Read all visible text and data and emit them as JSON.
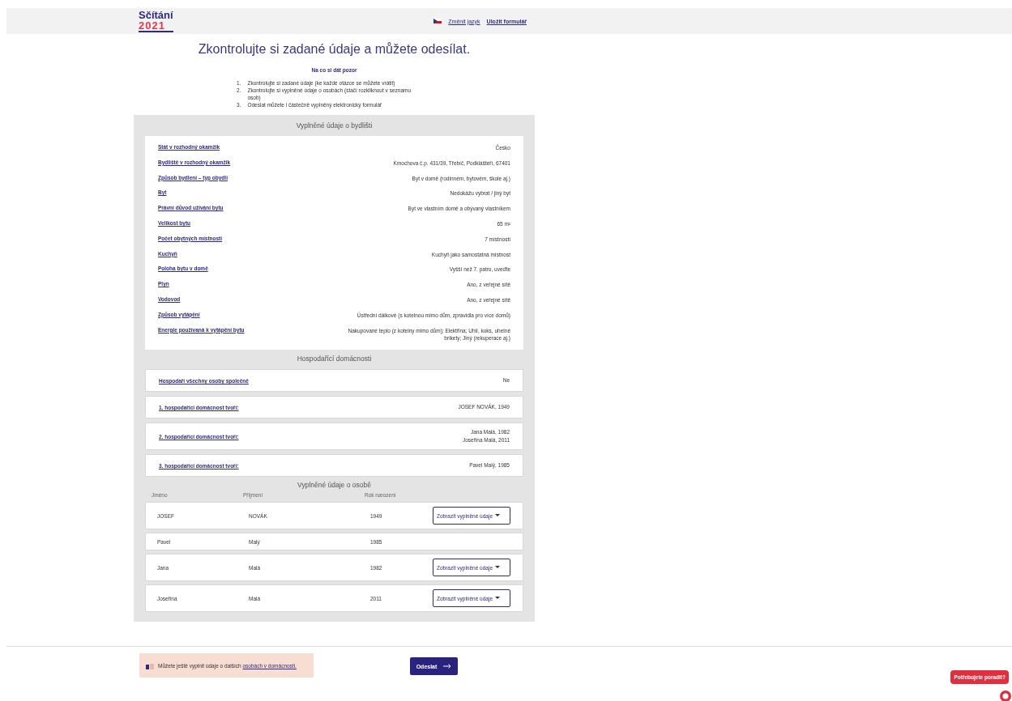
{
  "header": {
    "logo_word": "Sčítání",
    "logo_year": "2021",
    "language_link": "Změnit jazyk",
    "save_link": "Uložit formulář"
  },
  "title": "Zkontrolujte si zadané údaje a můžete odesílat.",
  "instructions": {
    "heading": "Na co si dát pozor",
    "items": [
      {
        "number": "1.",
        "text": "Zkontrolujte si zadané údaje (ke každé otázce se můžete vrátit)"
      },
      {
        "number": "2.",
        "text": "Zkontrolujte si vyplněné údaje o osobách (stačí rozkliknout v seznamu osob)"
      },
      {
        "number": "3.",
        "text": "Odeslat můžete i částečně vyplněný elektronický formulář"
      }
    ]
  },
  "dwelling": {
    "heading": "Vyplněné údaje o bydlišti",
    "rows": [
      {
        "label": "Stát v rozhodný okamžik",
        "value": "Česko"
      },
      {
        "label": "Bydliště v rozhodný okamžik",
        "value": "Kmochova č.p. 431/39, Třebíč, Podklášteří, 67401"
      },
      {
        "label": "Způsob bydlení – typ obydlí",
        "value": "Byt v domě (rodinném, bytovém, škole aj.)"
      },
      {
        "label": "Byt",
        "value": "Nedokážu vybrat / jiný byt"
      },
      {
        "label": "Právní důvod užívání bytu",
        "value": "Byt ve vlastním domě a obývaný vlastníkem"
      },
      {
        "label": "Velikost bytu",
        "value": "65 m²"
      },
      {
        "label": "Počet obytných místností",
        "value": "7 místností"
      },
      {
        "label": "Kuchyň",
        "value": "Kuchyň jako samostatná místnost"
      },
      {
        "label": "Poloha bytu v domě",
        "value": "Vyšší než 7. patro, uveďte"
      },
      {
        "label": "Plyn",
        "value": "Ano, z veřejné sítě"
      },
      {
        "label": "Vodovod",
        "value": "Ano, z veřejné sítě"
      },
      {
        "label": "Způsob vytápění",
        "value": "Ústřední dálkové (s kotelnou mimo dům, zpravidla pro více domů)"
      },
      {
        "label": "Energie používaná k vytápění bytu",
        "value": "Nakupované teplo (z kotelny mimo dům); Elektřina; Uhlí, koks, uhelné brikety; Jiný (rekuperace aj.)"
      }
    ]
  },
  "households": {
    "heading": "Hospodařící domácnosti",
    "rows": [
      {
        "label": "Hospodaří všechny osoby společně",
        "values": [
          "Ne"
        ]
      },
      {
        "label": "1. hospodařící domácnost tvoří:",
        "values": [
          "JOSEF NOVÁK, 1949"
        ]
      },
      {
        "label": "2. hospodařící domácnost tvoří:",
        "values": [
          "Jana Malá, 1982",
          "Josefína Malá, 2011"
        ]
      },
      {
        "label": "3. hospodařící domácnost tvoří:",
        "values": [
          "Pavel Malý, 1985"
        ]
      }
    ]
  },
  "persons": {
    "heading": "Vyplněné údaje o osobě",
    "columns": [
      "Jméno",
      "Příjmení",
      "Rok narození"
    ],
    "rows": [
      {
        "first_name": "JOSEF",
        "last_name": "NOVÁK",
        "birth_year": "1949",
        "button": "Zobrazit vyplněné údaje"
      },
      {
        "first_name": "Pavel",
        "last_name": "Malý",
        "birth_year": "1985"
      },
      {
        "first_name": "Jana",
        "last_name": "Malá",
        "birth_year": "1982",
        "button": "Zobrazit vyplněné údaje"
      },
      {
        "first_name": "Josefína",
        "last_name": "Malá",
        "birth_year": "2011",
        "button": "Zobrazit vyplněné údaje"
      }
    ]
  },
  "footer": {
    "notice_text": "Můžete ještě vyplnit údaje o dalších",
    "notice_link": "osobách v domácnosti.",
    "submit_button": "Odeslat"
  },
  "help_bubble": "Potřebujete poradit?"
}
